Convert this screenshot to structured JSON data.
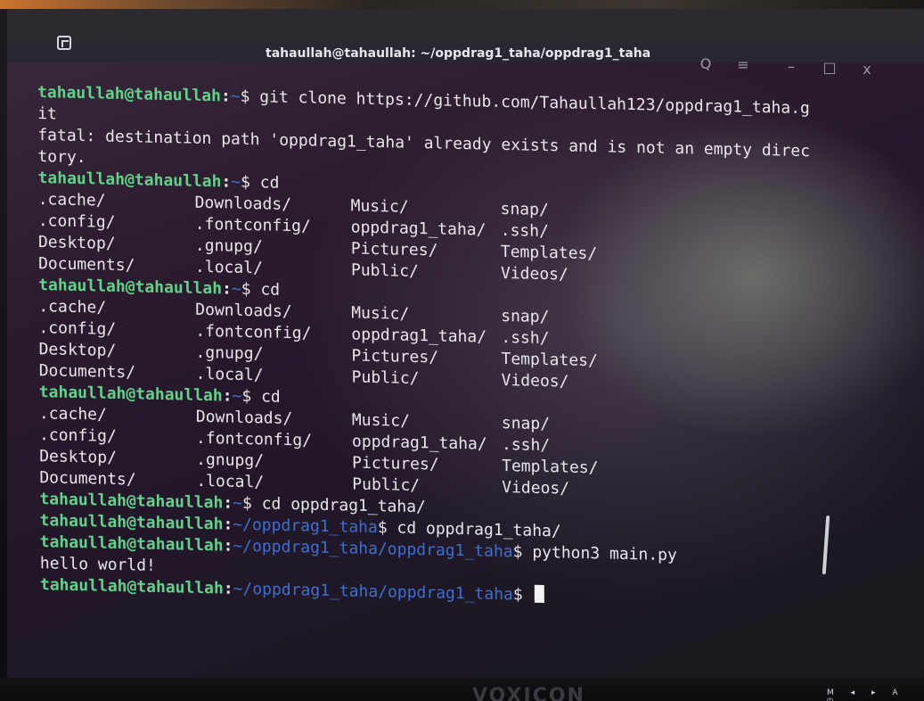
{
  "window": {
    "title": "tahaullah@tahaullah: ~/oppdrag1_taha/oppdrag1_taha",
    "buttons": {
      "search": "Q",
      "menu": "≡",
      "minimize": "–",
      "maximize": "□",
      "close": "x"
    }
  },
  "terminal": {
    "prompt_user": "tahaullah@tahaullah",
    "colon": ":",
    "path_home": "~",
    "path_repo": "~/oppdrag1_taha",
    "path_inner": "~/oppdrag1_taha/oppdrag1_taha",
    "dollar": "$",
    "cmd_clone_a": " git clone https://github.com/Tahaullah123/oppdrag1_taha.g",
    "cmd_clone_b": "it",
    "err_a": "fatal: destination path 'oppdrag1_taha' already exists and is not an empty direc",
    "err_b": "tory.",
    "cmd_cd": " cd",
    "cmd_cd_repo": " cd oppdrag1_taha/",
    "cmd_python": " python3 main.py",
    "output_hello": "hello world!",
    "ls_listing": [
      ".cache/",
      "Downloads/",
      "Music/",
      "snap/",
      ".config/",
      ".fontconfig/",
      "oppdrag1_taha/",
      ".ssh/",
      "Desktop/",
      ".gnupg/",
      "Pictures/",
      "Templates/",
      "Documents/",
      ".local/",
      "Public/",
      "Videos/"
    ]
  },
  "monitor": {
    "brand": "VOXICON",
    "keys": "M ◂ ▸ A ⏻"
  }
}
